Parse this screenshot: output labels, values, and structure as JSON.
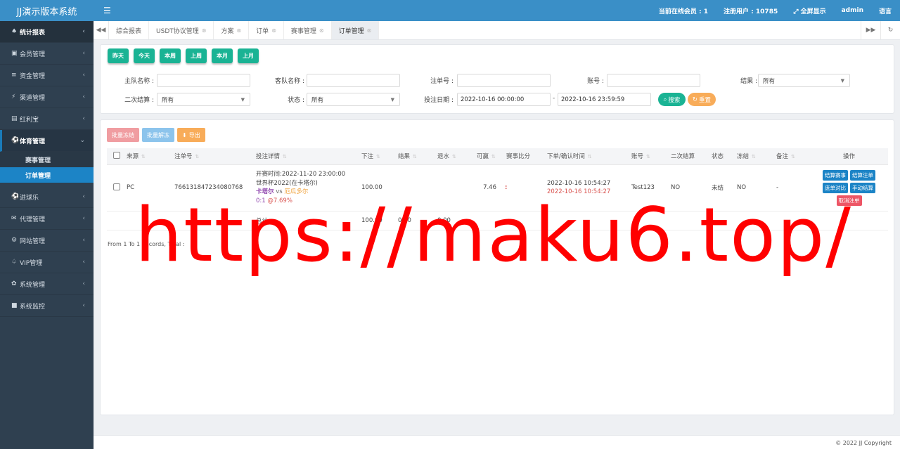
{
  "app": {
    "title": "JJ演示版本系统"
  },
  "sidebar": {
    "items": [
      {
        "icon": "home-icon",
        "glyph": "♠",
        "label": "统计报表"
      },
      {
        "icon": "member-icon",
        "glyph": "▣",
        "label": "会员管理"
      },
      {
        "icon": "database-icon",
        "glyph": "≡",
        "label": "资金管理"
      },
      {
        "icon": "channel-icon",
        "glyph": "⚡",
        "label": "渠道管理"
      },
      {
        "icon": "treasure-icon",
        "glyph": "▤",
        "label": "红利宝"
      },
      {
        "icon": "sports-icon",
        "glyph": "⚽",
        "label": "体育管理"
      },
      {
        "icon": "ball-icon",
        "glyph": "⚽",
        "label": "进球乐"
      },
      {
        "icon": "mail-icon",
        "glyph": "✉",
        "label": "代理管理"
      },
      {
        "icon": "settings-group-icon",
        "glyph": "⚙",
        "label": "网站管理"
      },
      {
        "icon": "vip-icon",
        "glyph": "♤",
        "label": "VIP管理"
      },
      {
        "icon": "gear-icon",
        "glyph": "✿",
        "label": "系统管理"
      },
      {
        "icon": "video-icon",
        "glyph": "■",
        "label": "系统监控"
      }
    ],
    "sub_items": [
      {
        "label": "赛事管理"
      },
      {
        "label": "订单管理"
      }
    ]
  },
  "topbar": {
    "online_label": "当前在线会员 : 1",
    "registered_label": "注册用户 : 10785",
    "fullscreen_label": "全屏显示",
    "user": "admin",
    "language": "语言"
  },
  "tabs": [
    {
      "label": "综合报表"
    },
    {
      "label": "USDT协议管理"
    },
    {
      "label": "方案"
    },
    {
      "label": "订单"
    },
    {
      "label": "赛事管理"
    },
    {
      "label": "订单管理"
    }
  ],
  "quick_dates": [
    "昨天",
    "今天",
    "本周",
    "上周",
    "本月",
    "上月"
  ],
  "filters": {
    "home_team": {
      "label": "主队名称 :",
      "value": ""
    },
    "away_team": {
      "label": "客队名称 :",
      "value": ""
    },
    "order_no": {
      "label": "注单号 :",
      "value": ""
    },
    "account": {
      "label": "账号 :",
      "value": ""
    },
    "result": {
      "label": "结果 :",
      "value": "所有"
    },
    "second_settle": {
      "label": "二次结算 :",
      "value": "所有"
    },
    "status": {
      "label": "状态 :",
      "value": "所有"
    },
    "bet_date": {
      "label": "投注日期 :",
      "start": "2022-10-16 00:00:00",
      "end": "2022-10-16 23:59:59"
    },
    "search_label": "搜索",
    "reset_label": "重置"
  },
  "actions": {
    "batch_freeze": "批量冻结",
    "batch_unfreeze": "批量解冻",
    "export": "导出"
  },
  "table": {
    "headers": [
      "来源",
      "注单号",
      "投注详情",
      "下注",
      "结果",
      "退水",
      "可赢",
      "赛事比分",
      "下单/确认时间",
      "账号",
      "二次结算",
      "状态",
      "冻结",
      "备注",
      "操作"
    ],
    "rows": [
      {
        "source": "PC",
        "order_no": "766131847234080768",
        "detail_start": "开赛时间:2022-11-20 23:00:00",
        "detail_league": "世界杯2022(在卡塔尔)",
        "detail_home": "卡塔尔",
        "detail_vs": "vs",
        "detail_away": "厄瓜多尔",
        "detail_pick": "0:1",
        "detail_odds": "@7.69%",
        "bet": "100.00",
        "result": "",
        "rebate": "",
        "win": "7.46",
        "score": ":",
        "order_time": "2022-10-16 10:54:27",
        "confirm_time": "2022-10-16 10:54:27",
        "account": "Test123",
        "second_settle": "NO",
        "status": "未结",
        "frozen": "NO",
        "remark": "-",
        "ops": [
          "结算赛事",
          "结算注单",
          "庞单对比",
          "手动结算",
          "取消注单"
        ]
      }
    ],
    "total": {
      "label": "总计:",
      "bet": "100.00",
      "result": "0.00",
      "rebate": "0.00"
    }
  },
  "pagination": {
    "text": "From 1 To 1 Records, Total :"
  },
  "watermark": "https://maku6.top/",
  "footer": {
    "copyright": "© 2022 JJ Copyright"
  }
}
